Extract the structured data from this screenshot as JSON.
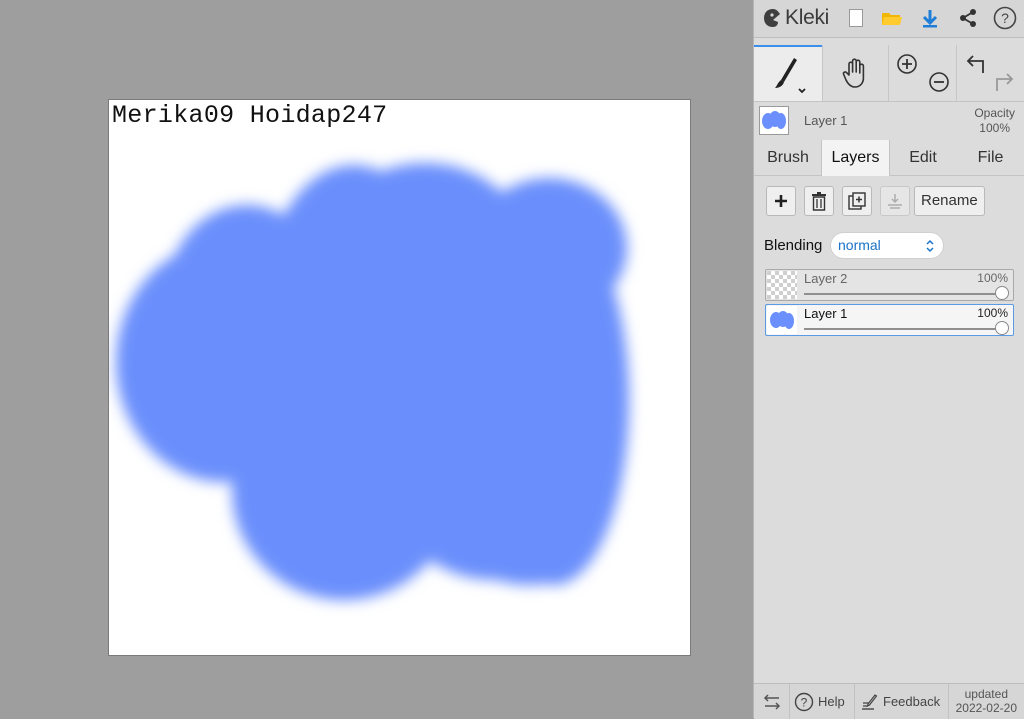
{
  "canvas": {
    "text": "Merika09 Hoidap247",
    "paint_color": "#6b8ffc"
  },
  "topbar": {
    "logo_text": "Kleki",
    "buttons": [
      "new-image-icon",
      "open-folder-icon",
      "download-icon",
      "share-icon",
      "help-icon"
    ]
  },
  "tools": {
    "brush": "brush-icon",
    "hand": "hand-icon",
    "zoom": [
      "zoom-in-icon",
      "zoom-out-icon"
    ],
    "history": [
      "undo-icon",
      "redo-icon"
    ]
  },
  "current_layer": {
    "name": "Layer 1",
    "opacity_label": "Opacity",
    "opacity_value": "100%"
  },
  "tabs": [
    {
      "label": "Brush",
      "active": false
    },
    {
      "label": "Layers",
      "active": true
    },
    {
      "label": "Edit",
      "active": false
    },
    {
      "label": "File",
      "active": false
    }
  ],
  "layer_actions": {
    "buttons": [
      "add-layer-icon",
      "delete-layer-icon",
      "duplicate-layer-icon",
      "merge-down-icon"
    ],
    "rename_label": "Rename"
  },
  "blending": {
    "label": "Blending",
    "value": "normal"
  },
  "layers": [
    {
      "name": "Layer 2",
      "opacity": "100%",
      "active": false
    },
    {
      "name": "Layer 1",
      "opacity": "100%",
      "active": true
    }
  ],
  "bottombar": {
    "help_label": "Help",
    "feedback_label": "Feedback",
    "updated_label": "updated",
    "updated_date": "2022-02-20"
  },
  "colors": {
    "accent": "#3b8eea",
    "select_text": "#1a73c9",
    "paint": "#6b8ffc"
  }
}
